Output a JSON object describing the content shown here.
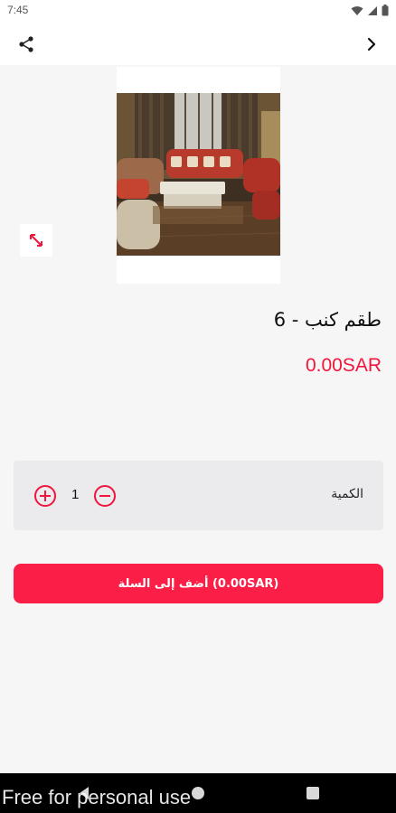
{
  "status_bar": {
    "time": "7:45",
    "icons": [
      "wifi-icon",
      "signal-icon",
      "battery-icon"
    ]
  },
  "app_bar": {
    "left_icon": "share-icon",
    "right_icon": "chevron-right-icon"
  },
  "product": {
    "title": "طقم كنب - 6",
    "price": "0.00SAR",
    "image_description_icon": "expand-icon"
  },
  "quantity": {
    "label": "الكمية",
    "value": "1"
  },
  "cart_button": {
    "label": "أضف إلى السلة (0.00SAR)"
  },
  "watermark": {
    "text": "Free for personal use"
  },
  "colors": {
    "accent": "#f0163d",
    "button": "#fb1f47",
    "qty_bg": "#ebebed"
  }
}
